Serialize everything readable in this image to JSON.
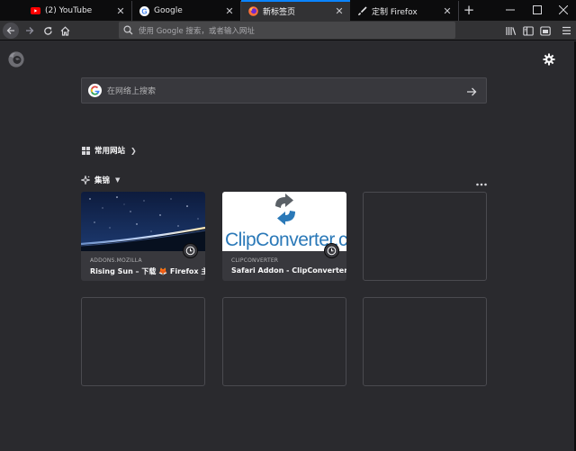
{
  "tabs": [
    {
      "label": "(2) YouTube",
      "icon": "youtube-icon",
      "active": false
    },
    {
      "label": "Google",
      "icon": "google-icon",
      "active": false
    },
    {
      "label": "新标签页",
      "icon": "firefox-icon",
      "active": true
    },
    {
      "label": "定制 Firefox",
      "icon": "brush-icon",
      "active": false
    }
  ],
  "urlbar": {
    "placeholder": "使用 Google 搜索，或者输入网址"
  },
  "search": {
    "placeholder": "在网络上搜索"
  },
  "topsites": {
    "heading": "常用网站"
  },
  "highlights": {
    "heading": "集锦",
    "cards": [
      {
        "source": "ADDONS.MOZILLA",
        "title": "Rising Sun – 下载 🦊 Firefox 主题..."
      },
      {
        "source": "CLIPCONVERTER",
        "title": "Safari Addon - ClipConverter.cc",
        "logo_text": "ClipConverter.cc"
      }
    ]
  },
  "colors": {
    "accent": "#0a84ff",
    "background": "#2a2a2e",
    "card": "#38383d",
    "clip_blue": "#2b79b8"
  }
}
